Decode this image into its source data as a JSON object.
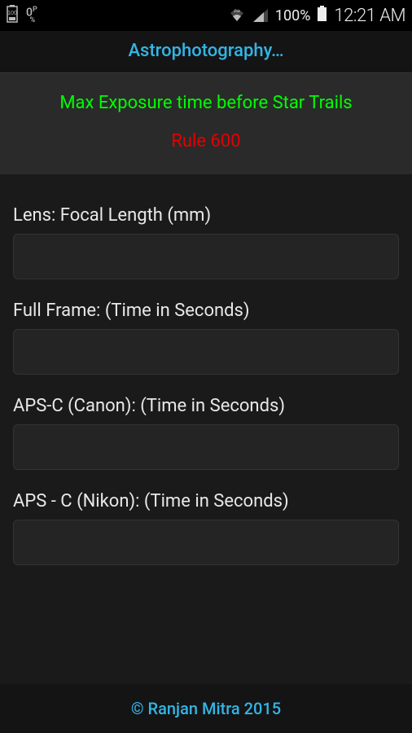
{
  "status_bar": {
    "battery_percent": "100%",
    "clock": "12:21 AM"
  },
  "header": {
    "title": "Astrophotography…"
  },
  "info": {
    "title": "Max Exposure time before Star Trails",
    "rule": "Rule 600"
  },
  "fields": {
    "focal_length": {
      "label": "Lens: Focal Length (mm)",
      "value": ""
    },
    "full_frame": {
      "label": "Full Frame: (Time in Seconds)",
      "value": ""
    },
    "apsc_canon": {
      "label": "APS-C (Canon): (Time in Seconds)",
      "value": ""
    },
    "apsc_nikon": {
      "label": "APS - C (Nikon): (Time in Seconds)",
      "value": ""
    }
  },
  "footer": {
    "copyright": "© Ranjan Mitra 2015"
  }
}
